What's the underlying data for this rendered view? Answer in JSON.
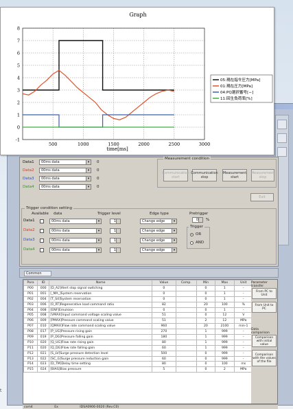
{
  "graph": {
    "title": "Graph",
    "xlabel": "time[ms]"
  },
  "chart_data": {
    "type": "line",
    "title": "Graph",
    "xlabel": "time[ms]",
    "ylabel": "",
    "xlim": [
      0,
      3000
    ],
    "ylim": [
      -1,
      8
    ],
    "xticks": [
      500,
      1000,
      1500,
      2000,
      2500,
      3000
    ],
    "yticks": [
      -1,
      0,
      1,
      2,
      3,
      4,
      5,
      6,
      7,
      8
    ],
    "grid": true,
    "legend_position": "right",
    "series": [
      {
        "name": "05:現在指令圧力[MPa]",
        "color": "#111111",
        "x": [
          0,
          600,
          600,
          1320,
          1320,
          2500
        ],
        "y": [
          3,
          3,
          7,
          7,
          3,
          3
        ]
      },
      {
        "name": "01:現在圧力[MPa]",
        "color": "#e0542a",
        "x": [
          0,
          100,
          200,
          300,
          400,
          500,
          600,
          700,
          800,
          900,
          1000,
          1100,
          1200,
          1300,
          1400,
          1500,
          1600,
          1700,
          1800,
          1900,
          2000,
          2100,
          2200,
          2300,
          2400,
          2500
        ],
        "y": [
          2.7,
          2.6,
          2.9,
          3.4,
          3.8,
          4.3,
          4.6,
          4.2,
          3.7,
          3.2,
          2.8,
          2.4,
          2.0,
          1.4,
          1.0,
          0.7,
          0.6,
          0.8,
          1.2,
          1.6,
          2.0,
          2.4,
          2.7,
          2.9,
          3.0,
          2.9
        ]
      },
      {
        "name": "04:PQ選択番号[−]",
        "color": "#3a5fb5",
        "x": [
          0,
          600,
          600,
          1320,
          1320,
          2500
        ],
        "y": [
          1,
          1,
          0,
          0,
          1,
          1
        ]
      },
      {
        "name": "11:回生負荷率[%]",
        "color": "#3cb03c",
        "x": [
          0,
          2500
        ],
        "y": [
          0,
          0
        ]
      }
    ]
  },
  "monitor": {
    "rows": [
      {
        "label": "Data1",
        "color": "#111111",
        "value": "00ms data",
        "num": "0"
      },
      {
        "label": "Data2",
        "color": "#d03a2a",
        "value": "00ms data",
        "num": "0"
      },
      {
        "label": "Data3",
        "color": "#2a50c0",
        "value": "00ms data",
        "num": "0"
      },
      {
        "label": "Data4",
        "color": "#2a9a2a",
        "value": "00ms data",
        "num": "0"
      }
    ],
    "measurement_condition": "Measurement condition",
    "buttons": {
      "comm_start": "Communication start",
      "comm_stop": "Communication stop",
      "meas_start": "Measurement start",
      "meas_stop": "Measurement stop",
      "exit": "Exit"
    }
  },
  "trigger": {
    "title": "Trigger condition setting",
    "headers": {
      "available": "Available",
      "data": "data",
      "level": "Trigger level",
      "edge": "Edge type",
      "pretrigger": "Pretrigger"
    },
    "rows": [
      {
        "label": "Data1",
        "color": "#111111",
        "data": "00ms data",
        "level": "1",
        "edge": "Change edge"
      },
      {
        "label": "Data2",
        "color": "#d03a2a",
        "data": "00ms data",
        "level": "1",
        "edge": "Change edge"
      },
      {
        "label": "Data3",
        "color": "#2a50c0",
        "data": "00ms data",
        "level": "1",
        "edge": "Change edge"
      },
      {
        "label": "Data4",
        "color": "#2a9a2a",
        "data": "00ms data",
        "level": "1",
        "edge": "Change edge"
      }
    ],
    "pretrigger_value": "0",
    "pretrigger_unit": "%",
    "trigger_group": "Trigger",
    "or_label": "OR",
    "and_label": "AND"
  },
  "tab": {
    "label": "Common"
  },
  "params": {
    "headers": [
      "Para",
      "ID",
      "Name",
      "Value",
      "Comp.",
      "Min",
      "Max",
      "Unit"
    ],
    "rows": [
      [
        "P00",
        "000",
        "[D_A2]Alert stop signal switching",
        "0",
        "",
        "0",
        "1",
        "-"
      ],
      [
        "P01",
        "001",
        "[_MA_]System reservation",
        "0",
        "",
        "0",
        "1",
        "-"
      ],
      [
        "P02",
        "004",
        "[T_S4]System reservation",
        "0",
        "",
        "0",
        "1",
        "-"
      ],
      [
        "P03",
        "006",
        "[0_RT]Regenerative load command ratio",
        "82",
        "",
        "20",
        "100",
        "%"
      ],
      [
        "P04",
        "008",
        "[ENF]Emulsion",
        "0",
        "",
        "0",
        "1",
        "-"
      ],
      [
        "P05",
        "008",
        "[VMAX]Input command voltage scaling value",
        "51",
        "",
        "0",
        "12",
        "V"
      ],
      [
        "P06",
        "009",
        "[PMAX]Pressure command scaling value",
        "51",
        "",
        "2",
        "12",
        "MPa"
      ],
      [
        "P07",
        "010",
        "[QMAX]Flow rate command scaling value",
        "960",
        "",
        "20",
        "2100",
        "min-1"
      ],
      [
        "P08",
        "017",
        "[P_UG]Pressure rising gain",
        "270",
        "",
        "1",
        "999",
        "-"
      ],
      [
        "P09",
        "019",
        "[P_DG]Pressure falling gain",
        "180",
        "",
        "1",
        "999",
        "-"
      ],
      [
        "P10",
        "020",
        "[Q_UG]Flow rate rising gain",
        "80",
        "",
        "1",
        "999",
        "-"
      ],
      [
        "P11",
        "020",
        "[Q_DG]Flow rate falling gain",
        "60",
        "",
        "1",
        "999",
        "-"
      ],
      [
        "P12",
        "021",
        "[S_LV]Surge pressure detection level",
        "500",
        "",
        "0",
        "999",
        "-"
      ],
      [
        "P13",
        "022",
        "[SC_G]Surge pressure reduction gain",
        "60",
        "",
        "0",
        "999",
        "-"
      ],
      [
        "P14",
        "023",
        "[D_TM]Delay time setting",
        "80",
        "",
        "0",
        "100",
        "ms"
      ],
      [
        "P15",
        "024",
        "[BIAS]Bias pressure",
        "5",
        "",
        "0",
        "2",
        "MPa"
      ]
    ]
  },
  "side": {
    "param_transfer": "Parameter transfer",
    "pc_to_unit": "From PC to Unit",
    "unit_to_pc": "From Unit to PC",
    "data_comparison": "Data comparison",
    "cmp_initial": "Comparison with initial value",
    "cmp_file": "Comparison with the values of the file"
  },
  "status": {
    "left": "com4",
    "mid": "Ex",
    "right": "IDSA0906-0020 (Rev.C0)"
  },
  "left_label": "t"
}
